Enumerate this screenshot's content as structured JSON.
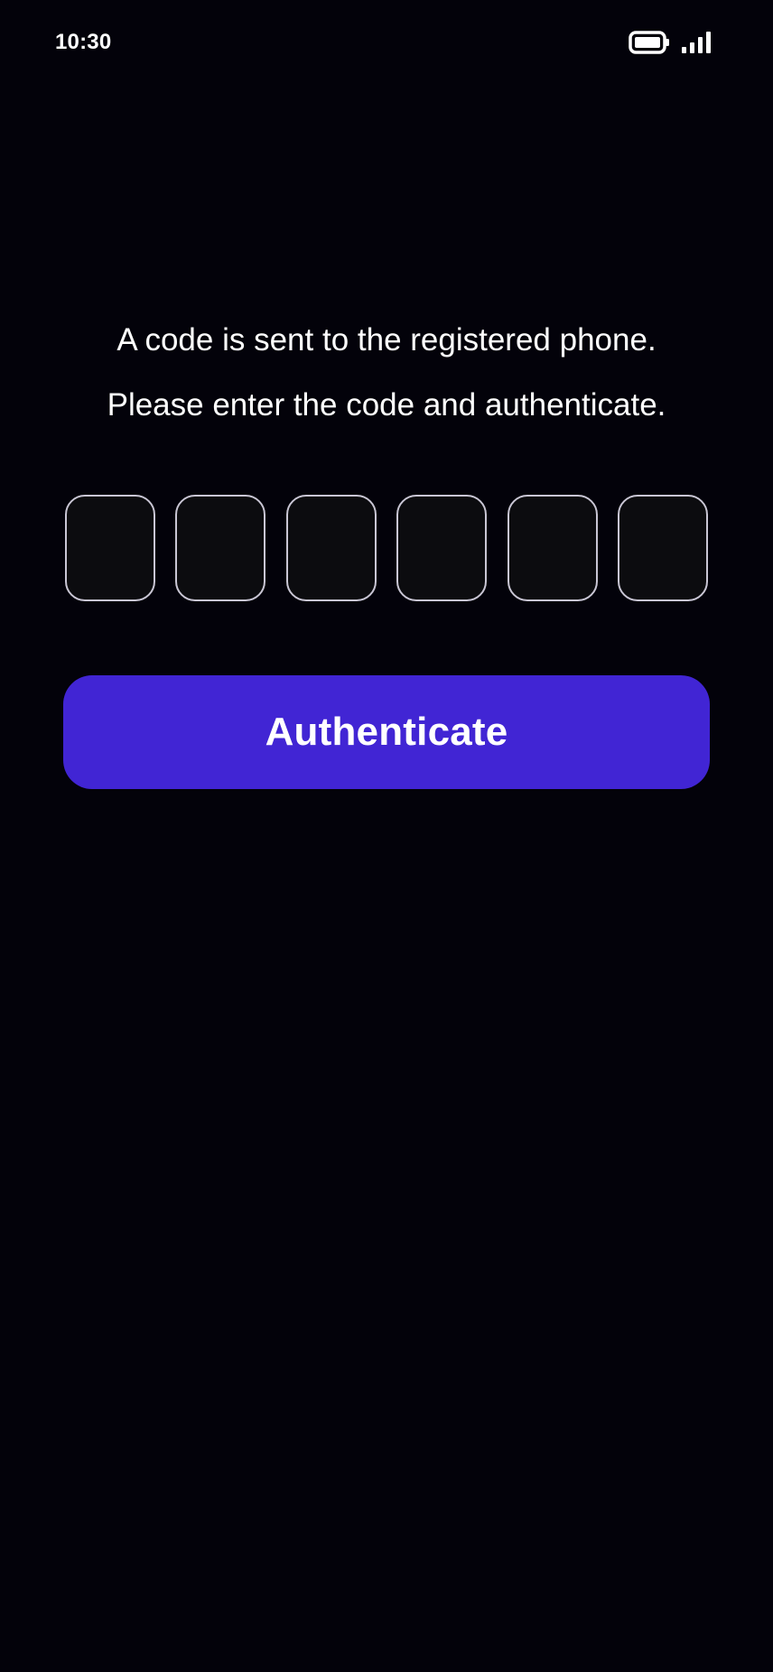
{
  "status_bar": {
    "time": "10:30",
    "icons": [
      "battery-icon",
      "signal-icon"
    ]
  },
  "instructions": {
    "line1": "A code is sent to the registered phone.",
    "line2": "Please enter the code and authenticate."
  },
  "code_input": {
    "digits": [
      "",
      "",
      "",
      "",
      "",
      ""
    ]
  },
  "auth_button": {
    "label": "Authenticate"
  },
  "colors": {
    "background": "#03020a",
    "accent": "#4125d4",
    "box_border": "#c9c6d4",
    "box_fill": "#0c0c0f",
    "text": "#ffffff"
  }
}
